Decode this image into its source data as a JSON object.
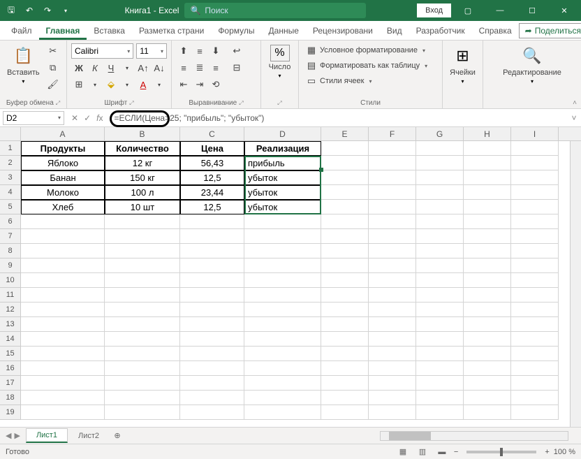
{
  "title": {
    "document": "Книга1 - Excel",
    "search_placeholder": "Поиск",
    "login": "Вход"
  },
  "tabs": [
    "Файл",
    "Главная",
    "Вставка",
    "Разметка страни",
    "Формулы",
    "Данные",
    "Рецензировани",
    "Вид",
    "Разработчик",
    "Справка"
  ],
  "active_tab": "Главная",
  "share": "Поделиться",
  "ribbon": {
    "clipboard": {
      "paste": "Вставить",
      "label": "Буфер обмена"
    },
    "font": {
      "name": "Calibri",
      "size": "11",
      "label": "Шрифт"
    },
    "align": {
      "label": "Выравнивание"
    },
    "number": {
      "fmt": "%",
      "label": "Число"
    },
    "styles": {
      "cond": "Условное форматирование",
      "table": "Форматировать как таблицу",
      "cell": "Стили ячеек",
      "label": "Стили"
    },
    "cells": {
      "label": "Ячейки"
    },
    "editing": {
      "label": "Редактирование"
    }
  },
  "formula_bar": {
    "name_box": "D2",
    "formula": "=ЕСЛИ(Цена>25; \"прибыль\"; \"убыток\")"
  },
  "columns": [
    "A",
    "B",
    "C",
    "D",
    "E",
    "F",
    "G",
    "H",
    "I"
  ],
  "headers": [
    "Продукты",
    "Количество",
    "Цена",
    "Реализация"
  ],
  "rows": [
    {
      "n": 1
    },
    {
      "n": 2,
      "a": "Яблоко",
      "b": "12 кг",
      "c": "56,43",
      "d": "прибыль"
    },
    {
      "n": 3,
      "a": "Банан",
      "b": "150 кг",
      "c": "12,5",
      "d": "убыток"
    },
    {
      "n": 4,
      "a": "Молоко",
      "b": "100 л",
      "c": "23,44",
      "d": "убыток"
    },
    {
      "n": 5,
      "a": "Хлеб",
      "b": "10 шт",
      "c": "12,5",
      "d": "убыток"
    },
    {
      "n": 6
    },
    {
      "n": 7
    },
    {
      "n": 8
    },
    {
      "n": 9
    },
    {
      "n": 10
    },
    {
      "n": 11
    },
    {
      "n": 12
    },
    {
      "n": 13
    },
    {
      "n": 14
    },
    {
      "n": 15
    },
    {
      "n": 16
    },
    {
      "n": 17
    },
    {
      "n": 18
    },
    {
      "n": 19
    }
  ],
  "sheets": [
    "Лист1",
    "Лист2"
  ],
  "status": {
    "ready": "Готово",
    "zoom": "100 %"
  }
}
